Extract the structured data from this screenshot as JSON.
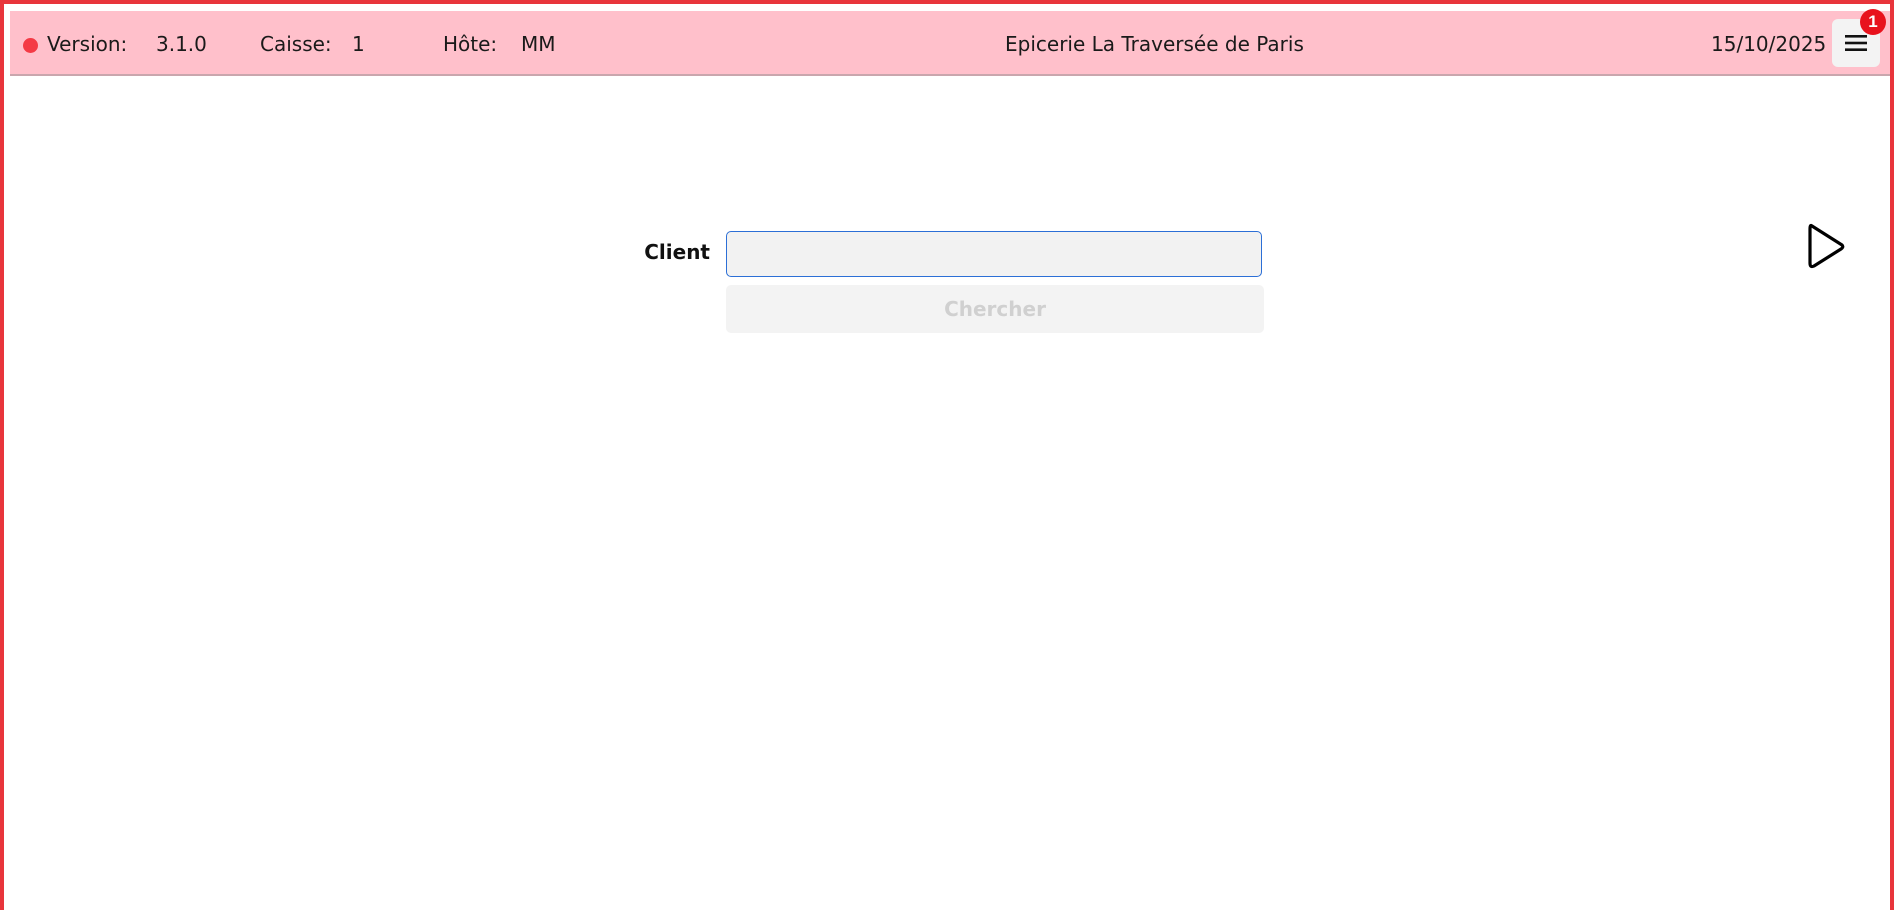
{
  "topbar": {
    "version_label": "Version:",
    "version_value": "3.1.0",
    "register_label": "Caisse:",
    "register_value": "1",
    "host_label": "Hôte:",
    "host_value": "MM",
    "store_name": "Epicerie La Traversée de Paris",
    "date": "15/10/2025",
    "notification_count": "1",
    "status_color": "#f43a45",
    "background_color": "#ffc0cb",
    "menu_icon": "hamburger-menu-icon"
  },
  "client_search": {
    "label": "Client",
    "input_value": "",
    "input_placeholder": "",
    "button_label": "Chercher",
    "button_disabled": true
  },
  "colors": {
    "window_border": "#e8353b",
    "input_focus_border": "#2c6fd6",
    "badge": "#e8121d"
  }
}
